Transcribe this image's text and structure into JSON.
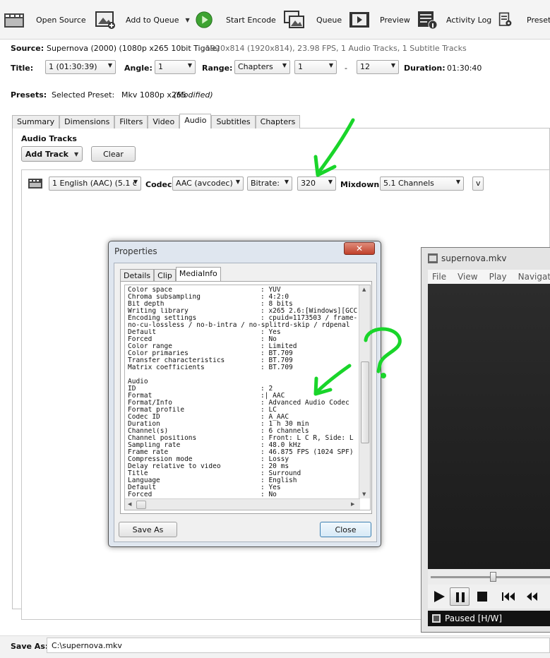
{
  "toolbar": {
    "open_source": "Open Source",
    "add_to_queue": "Add to Queue",
    "start_encode": "Start Encode",
    "queue": "Queue",
    "preview": "Preview",
    "activity_log": "Activity Log",
    "presets": "Presets"
  },
  "source": {
    "label": "Source:",
    "name": "Supernova (2000) (1080p x265 10bit Tigole)",
    "details": "1920x814 (1920x814), 23.98 FPS, 1 Audio Tracks, 1 Subtitle Tracks"
  },
  "title_row": {
    "title_label": "Title:",
    "title_value": "1 (01:30:39)",
    "angle_label": "Angle:",
    "angle_value": "1",
    "range_label": "Range:",
    "range_value": "Chapters",
    "range_start": "1",
    "range_dash": "-",
    "range_end": "12",
    "duration_label": "Duration:",
    "duration_value": "01:30:40"
  },
  "presets": {
    "label": "Presets:",
    "selected_label": "Selected Preset:",
    "selected_value": "Mkv 1080p x265",
    "modified": "(Modified)"
  },
  "tabs": [
    "Summary",
    "Dimensions",
    "Filters",
    "Video",
    "Audio",
    "Subtitles",
    "Chapters"
  ],
  "active_tab": "Audio",
  "audio": {
    "heading": "Audio Tracks",
    "add_track": "Add Track",
    "clear": "Clear",
    "track_value": "1 English (AAC) (5.1 c",
    "codec_label": "Codec",
    "codec_value": "AAC (avcodec)",
    "bitrate_mode": "Bitrate:",
    "bitrate_value": "320",
    "mixdown_label": "Mixdown",
    "mixdown_value": "5.1 Channels",
    "more": "v"
  },
  "dialog": {
    "title": "Properties",
    "tabs": [
      "Details",
      "Clip",
      "MediaInfo"
    ],
    "active_tab": "MediaInfo",
    "mediainfo": [
      {
        "k": "Color space",
        "v": ": YUV"
      },
      {
        "k": "Chroma subsampling",
        "v": ": 4:2:0"
      },
      {
        "k": "Bit depth",
        "v": ": 8 bits"
      },
      {
        "k": "Writing library",
        "v": ": x265 2.6:[Windows][GCC"
      },
      {
        "k": "Encoding settings",
        "v": ": cpuid=1173503 / frame-"
      },
      {
        "full": "no-cu-lossless / no-b-intra / no-splitrd-skip / rdpenal"
      },
      {
        "k": "Default",
        "v": ": Yes"
      },
      {
        "k": "Forced",
        "v": ": No"
      },
      {
        "k": "Color range",
        "v": ": Limited"
      },
      {
        "k": "Color primaries",
        "v": ": BT.709"
      },
      {
        "k": "Transfer characteristics",
        "v": ": BT.709"
      },
      {
        "k": "Matrix coefficients",
        "v": ": BT.709"
      },
      {
        "full": ""
      },
      {
        "full": "Audio"
      },
      {
        "k": "ID",
        "v": ": 2"
      },
      {
        "k": "Format",
        "v": ":| AAC"
      },
      {
        "k": "Format/Info",
        "v": ": Advanced Audio Codec"
      },
      {
        "k": "Format profile",
        "v": ": LC"
      },
      {
        "k": "Codec ID",
        "v": ": A_AAC"
      },
      {
        "k": "Duration",
        "v": ": 1 h 30 min"
      },
      {
        "k": "Channel(s)",
        "v": ": 6 channels"
      },
      {
        "k": "Channel positions",
        "v": ": Front: L C R, Side: L"
      },
      {
        "k": "Sampling rate",
        "v": ": 48.0 kHz"
      },
      {
        "k": "Frame rate",
        "v": ": 46.875 FPS (1024 SPF)"
      },
      {
        "k": "Compression mode",
        "v": ": Lossy"
      },
      {
        "k": "Delay relative to video",
        "v": ": 20 ms"
      },
      {
        "k": "Title",
        "v": ": Surround"
      },
      {
        "k": "Language",
        "v": ": English"
      },
      {
        "k": "Default",
        "v": ": Yes"
      },
      {
        "k": "Forced",
        "v": ": No"
      }
    ],
    "save_as": "Save As",
    "close": "Close"
  },
  "player": {
    "title": "supernova.mkv",
    "menu": [
      "File",
      "View",
      "Play",
      "Navigate"
    ],
    "status": "Paused [H/W]"
  },
  "save_as": {
    "label": "Save As:",
    "value": "C:\\supernova.mkv"
  },
  "annotations": {
    "question": "?"
  },
  "colors": {
    "annotation_green": "#19d52a",
    "start_encode_green": "#3ea332",
    "close_button_red": "#c7442e"
  }
}
